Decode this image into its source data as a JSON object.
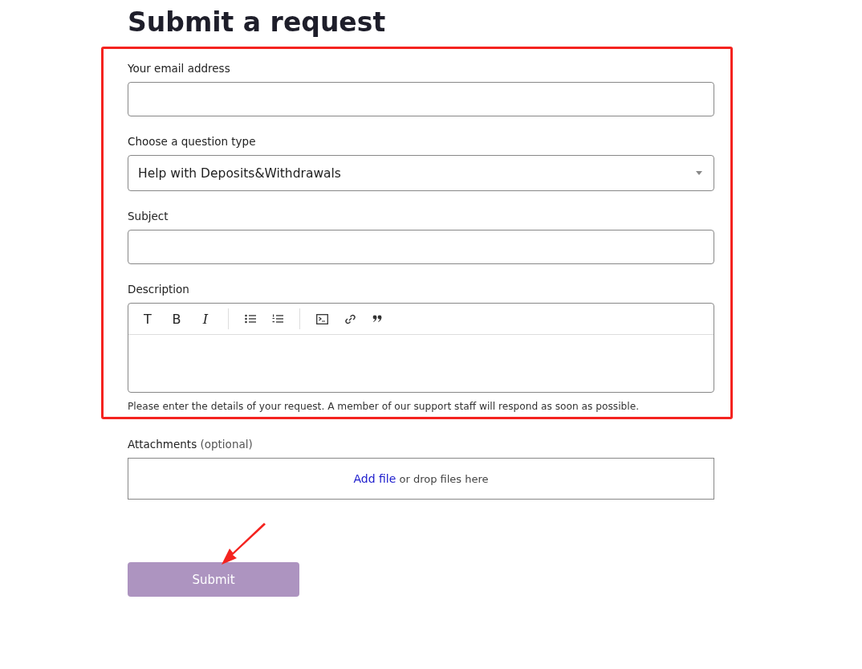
{
  "title": "Submit a request",
  "fields": [
    {
      "kind": "text",
      "label": "Your email address"
    },
    {
      "kind": "select",
      "label": "Choose a question type",
      "value": "Help with Deposits&Withdrawals"
    },
    {
      "kind": "text",
      "label": "Subject"
    },
    {
      "kind": "editor",
      "label": "Description",
      "toolbar": [
        "T",
        "B",
        "I"
      ],
      "hint": "Please enter the details of your request. A member of our support staff will respond as soon as possible."
    }
  ],
  "attachments": {
    "label": "Attachments",
    "optional": "(optional)",
    "link": "Add file",
    "rest": "or drop files here"
  },
  "submit": "Submit"
}
